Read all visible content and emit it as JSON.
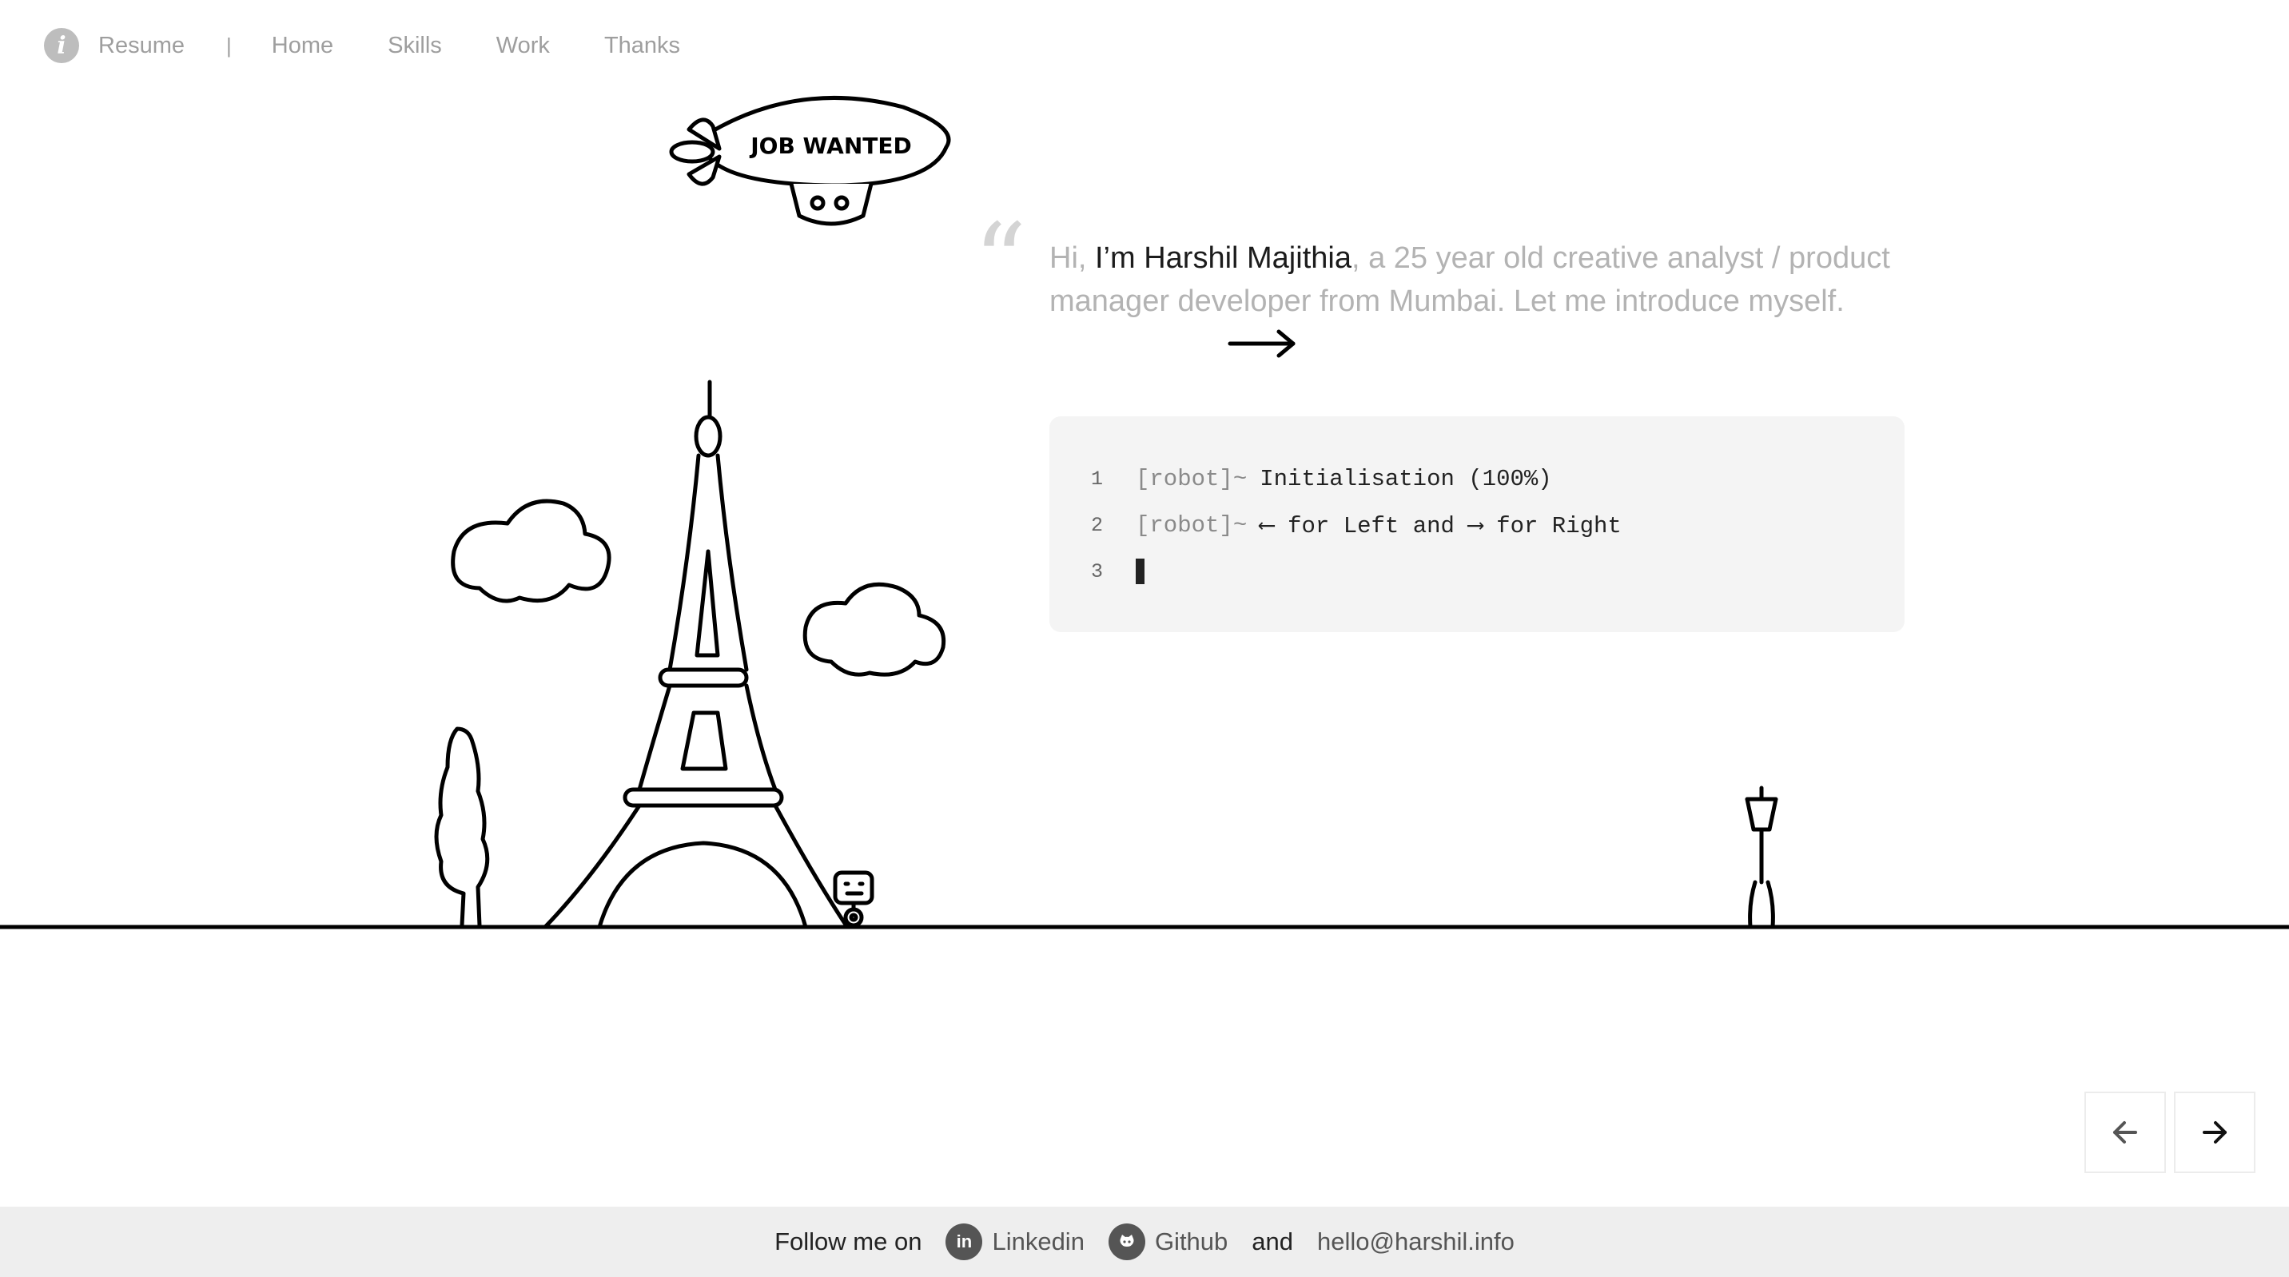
{
  "nav": {
    "info_icon": "info-icon",
    "resume": "Resume",
    "separator": "|",
    "links": [
      "Home",
      "Skills",
      "Work",
      "Thanks"
    ]
  },
  "scene": {
    "blimp_label": "JOB WANTED"
  },
  "intro": {
    "quote_mark": "“",
    "greeting": "Hi, ",
    "name": "I’m Harshil Majithia",
    "description": ", a 25 year old creative analyst / product manager developer from Mumbai. Let me introduce myself."
  },
  "terminal": {
    "lines": [
      {
        "num": "1",
        "prompt": "[robot]~",
        "text": "Initialisation (100%)"
      },
      {
        "num": "2",
        "prompt": "[robot]~",
        "text": "⟵ for Left and ⟶ for Right"
      },
      {
        "num": "3",
        "prompt": "",
        "text": ""
      }
    ]
  },
  "pager": {
    "prev_icon": "arrow-left-icon",
    "next_icon": "arrow-right-icon"
  },
  "footer": {
    "follow": "Follow me on",
    "linkedin": "Linkedin",
    "linkedin_badge": "in",
    "github": "Github",
    "and": "and",
    "email": "hello@harshil.info"
  }
}
